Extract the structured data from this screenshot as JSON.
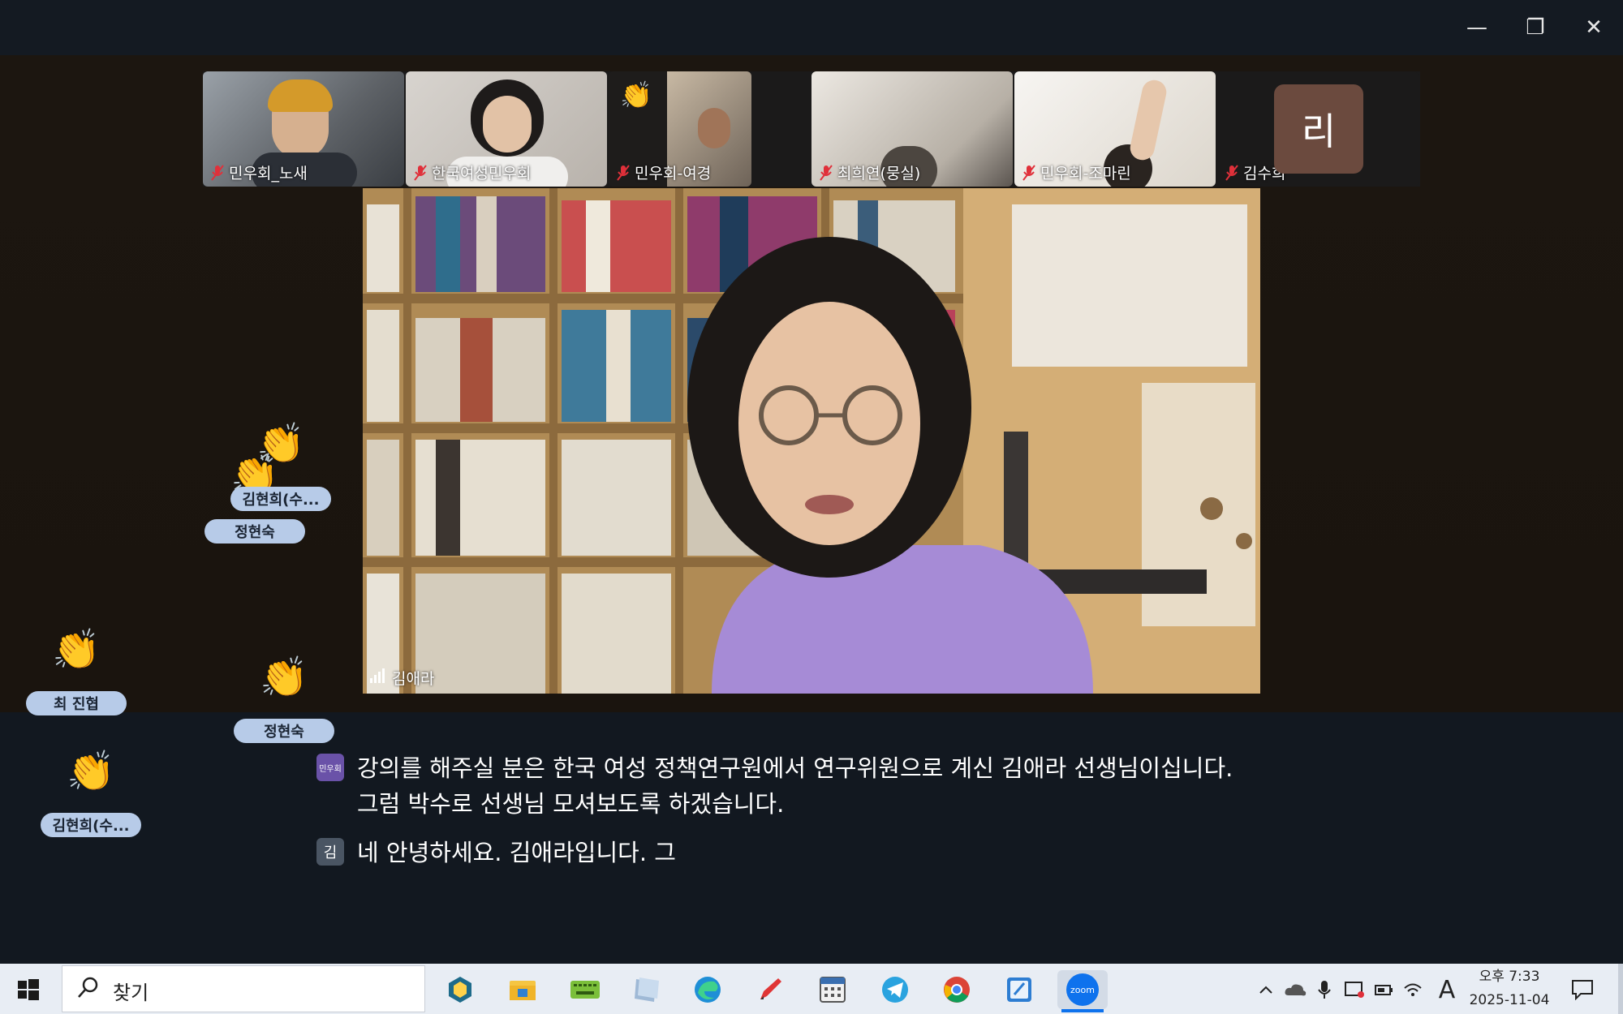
{
  "window": {
    "controls": {
      "minimize": "—",
      "restore": "❐",
      "close": "✕"
    }
  },
  "participants": [
    {
      "name": "민우회_노새",
      "muted": true
    },
    {
      "name": "한국여성민우회",
      "muted": true
    },
    {
      "name": "민우회-여경",
      "muted": true,
      "reaction": "👏"
    },
    {
      "name": "최희연(뭉실)",
      "muted": true
    },
    {
      "name": "민우회-조마린",
      "muted": true
    },
    {
      "name": "김수희",
      "muted": true,
      "avatar_letter": "리"
    }
  ],
  "speaker": {
    "name": "김애라"
  },
  "reactions": [
    {
      "emoji": "👏",
      "name": "김현희(수..."
    },
    {
      "emoji": "👏",
      "name": "정현숙"
    },
    {
      "emoji": "👏",
      "name": "최 진협"
    },
    {
      "emoji": "👏",
      "name": "정현숙"
    },
    {
      "emoji": "👏",
      "name": "김현희(수..."
    }
  ],
  "captions": [
    {
      "icon": "민우회",
      "lines": [
        "강의를 해주실 분은 한국 여성 정책연구원에서 연구위원으로 계신 김애라 선생님이십니다.",
        "그럼 박수로 선생님 모셔보도록 하겠습니다."
      ]
    },
    {
      "icon": "김",
      "lines": [
        "네 안녕하세요. 김애라입니다. 그"
      ]
    }
  ],
  "taskbar": {
    "search_placeholder": "찾기",
    "apps": [
      "snipping-tool",
      "file-explorer",
      "keyboard-app",
      "notes-app",
      "edge",
      "pen-app",
      "calculator",
      "telegram",
      "chrome",
      "paint-app",
      "zoom"
    ],
    "zoom_label": "zoom",
    "ime": "A",
    "time": "오후 7:33",
    "date": "2025-11-04"
  },
  "colors": {
    "accent": "#0e72ed",
    "pill": "#b7cbe8",
    "mute": "#e0303a"
  }
}
